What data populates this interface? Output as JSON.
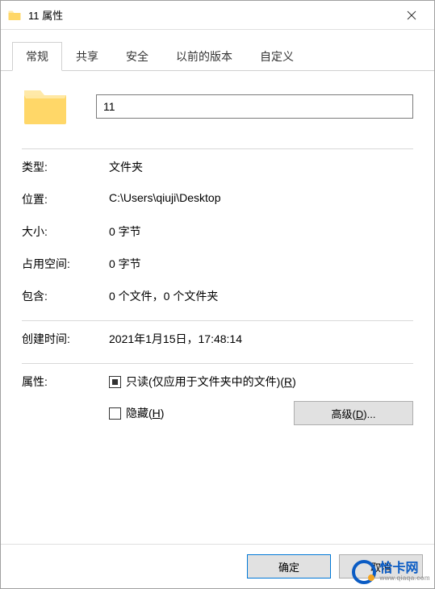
{
  "titlebar": {
    "title": "11 属性"
  },
  "tabs": {
    "general": "常规",
    "sharing": "共享",
    "security": "安全",
    "previous": "以前的版本",
    "custom": "自定义"
  },
  "name_value": "11",
  "props": {
    "type_label": "类型:",
    "type_value": "文件夹",
    "location_label": "位置:",
    "location_value": "C:\\Users\\qiuji\\Desktop",
    "size_label": "大小:",
    "size_value": "0 字节",
    "diskspace_label": "占用空间:",
    "diskspace_value": "0 字节",
    "contains_label": "包含:",
    "contains_value": "0 个文件，0 个文件夹",
    "created_label": "创建时间:",
    "created_value": "2021年1月15日，17:48:14",
    "attr_label": "属性:"
  },
  "checkboxes": {
    "readonly_prefix": "只读(仅应用于文件夹中的文件)(",
    "readonly_key": "R",
    "readonly_suffix": ")",
    "hidden_prefix": "隐藏(",
    "hidden_key": "H",
    "hidden_suffix": ")"
  },
  "buttons": {
    "advanced_prefix": "高级(",
    "advanced_key": "D",
    "advanced_suffix": ")...",
    "ok": "确定",
    "cancel": "取消"
  },
  "watermark": {
    "main": "恰卡网",
    "sub": "www.qiaqa.com"
  }
}
